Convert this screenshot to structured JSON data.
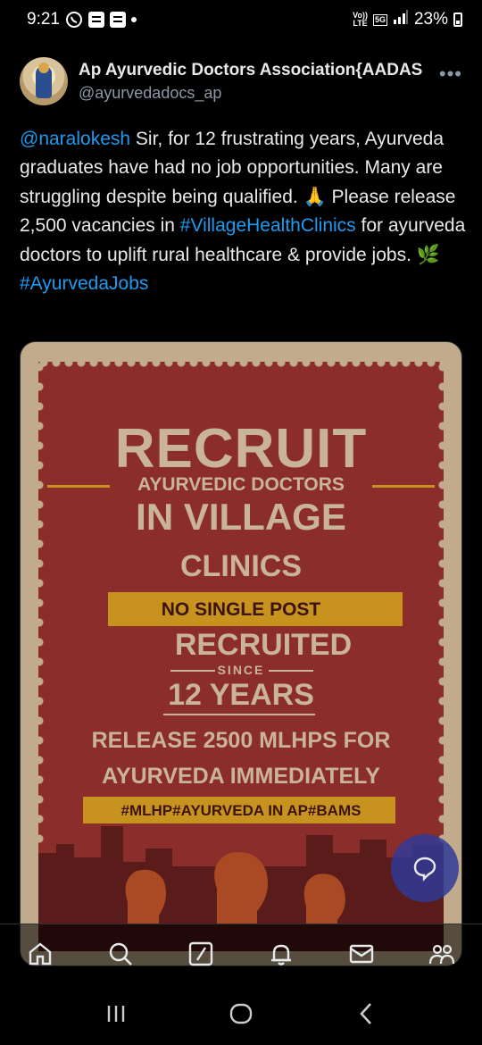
{
  "status_bar": {
    "time": "9:21",
    "network_top": "Vo))",
    "network_bottom": "LTE",
    "generation": "5G",
    "battery": "23%"
  },
  "tweet": {
    "author_name": "Ap Ayurvedic Doctors Association{AADAS",
    "author_handle": "@ayurvedadocs_ap",
    "more_label": "•••",
    "text": {
      "mention": "@naralokesh",
      "part1": " Sir, for 12 frustrating years, Ayurveda graduates have had no job opportunities. Many are struggling despite being qualified. 🙏 Please release 2,500 vacancies in ",
      "hashtag1": "#VillageHealthClinics",
      "part2": " for ayurveda doctors to uplift rural healthcare & provide jobs. ",
      "emoji2": "🌿",
      "hashtag2": "#AyurvedaJobs"
    }
  },
  "poster": {
    "recruit": "RECRUIT",
    "ayurvedic_doctors": "AYURVEDIC DOCTORS",
    "in_village": "IN VILLAGE",
    "clinics": "CLINICS",
    "no_single_post": "NO SINGLE POST",
    "recruited": "RECRUITED",
    "since": "SINCE",
    "years": "12 YEARS",
    "release": "RELEASE  2500 MLHPS FOR",
    "immediately": "AYURVEDA IMMEDIATELY",
    "tags": "#MLHP#AYURVEDA IN AP#BAMS",
    "colors": {
      "background": "#8b2e2b",
      "gold": "#c8921f",
      "text": "#c9b49a",
      "frame": "#c2ab8c"
    }
  },
  "bottom_nav": {
    "items": [
      "home-icon",
      "search-icon",
      "grok-icon",
      "notifications-icon",
      "messages-icon",
      "communities-icon"
    ]
  },
  "system_nav": {
    "items": [
      "recents-icon",
      "home-circle-icon",
      "back-icon"
    ]
  },
  "colors": {
    "link": "#1d9bf0",
    "muted": "#8b98a5",
    "fab": "#303a96"
  }
}
